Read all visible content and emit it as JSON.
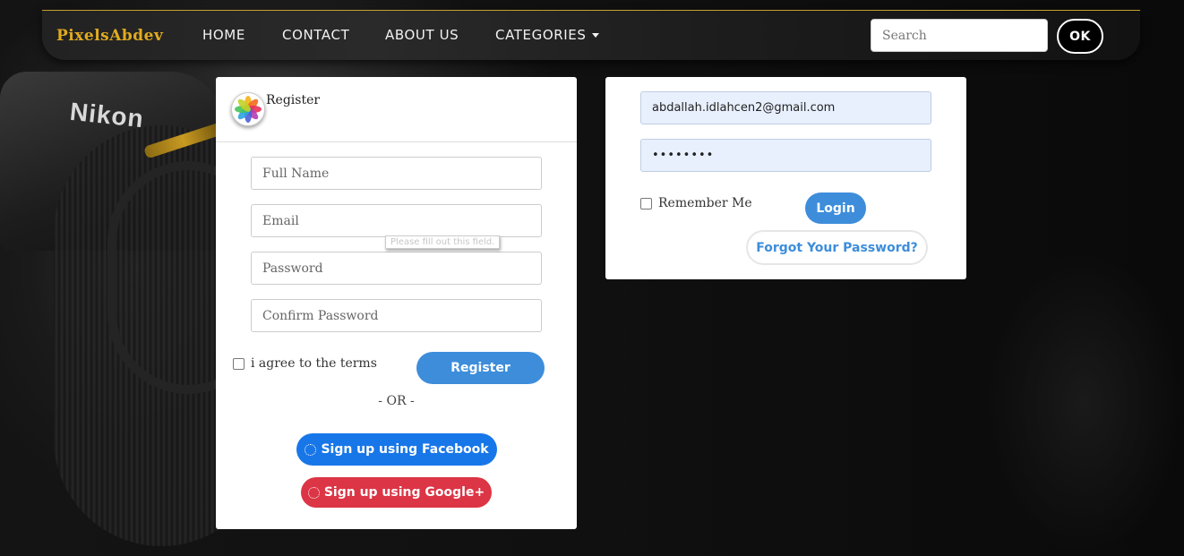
{
  "navbar": {
    "logo": "PixelsAbdev",
    "items": [
      {
        "label": "HOME"
      },
      {
        "label": "CONTACT"
      },
      {
        "label": "ABOUT US"
      },
      {
        "label": "CATEGORIES"
      }
    ],
    "search_placeholder": "Search",
    "ok_label": "OK"
  },
  "background": {
    "brand_text": "Nikon"
  },
  "register": {
    "title": "Register",
    "fields": {
      "full_name_placeholder": "Full Name",
      "email_placeholder": "Email",
      "password_placeholder": "Password",
      "confirm_password_placeholder": "Confirm Password"
    },
    "validation_tooltip": "Please fill out this field.",
    "terms_label": "i agree to the terms",
    "register_label": "Register",
    "or_text": "- OR -",
    "facebook_label": "Sign up using Facebook",
    "google_label": "Sign up using Google+"
  },
  "login": {
    "email_value": "abdallah.idlahcen2@gmail.com",
    "password_value": "••••••••",
    "remember_label": "Remember Me",
    "login_label": "Login",
    "forgot_label": "Forgot Your Password?"
  },
  "colors": {
    "accent_gold": "#e0ab1f",
    "primary_blue": "#3d8ddb",
    "facebook_blue": "#1877e8",
    "google_red": "#dc3545"
  }
}
